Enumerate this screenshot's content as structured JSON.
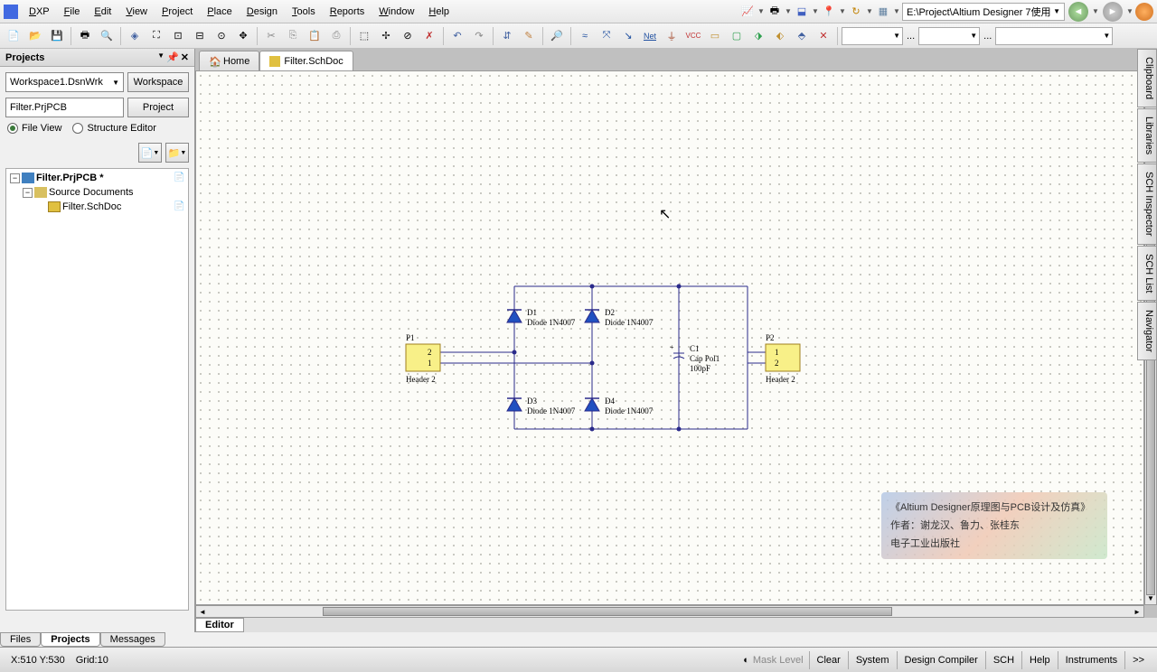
{
  "menubar": {
    "app": "DXP",
    "items": [
      "File",
      "Edit",
      "View",
      "Project",
      "Place",
      "Design",
      "Tools",
      "Reports",
      "Window",
      "Help"
    ],
    "path": "E:\\Project\\Altium Designer 7使用"
  },
  "projects_panel": {
    "title": "Projects",
    "workspace_combo": "Workspace1.DsnWrk",
    "workspace_btn": "Workspace",
    "project_field": "Filter.PrjPCB",
    "project_btn": "Project",
    "radio_file_view": "File View",
    "radio_structure": "Structure Editor",
    "tree": {
      "project": "Filter.PrjPCB *",
      "folder": "Source Documents",
      "doc": "Filter.SchDoc"
    }
  },
  "tabs": {
    "home": "Home",
    "doc": "Filter.SchDoc",
    "editor": "Editor"
  },
  "panel_tabs": {
    "files": "Files",
    "projects": "Projects",
    "messages": "Messages"
  },
  "right_tabs": [
    "Clipboard",
    "Libraries",
    "SCH Inspector",
    "SCH List",
    "Navigator"
  ],
  "schematic": {
    "p1": {
      "ref": "P1",
      "type": "Header 2",
      "pin1": "1",
      "pin2": "2"
    },
    "p2": {
      "ref": "P2",
      "type": "Header 2",
      "pin1": "1",
      "pin2": "2"
    },
    "d1": {
      "ref": "D1",
      "type": "Diode 1N4007"
    },
    "d2": {
      "ref": "D2",
      "type": "Diode 1N4007"
    },
    "d3": {
      "ref": "D3",
      "type": "Diode 1N4007"
    },
    "d4": {
      "ref": "D4",
      "type": "Diode 1N4007"
    },
    "c1": {
      "ref": "C1",
      "type": "Cap Pol1",
      "value": "100pF"
    }
  },
  "watermark": {
    "line1": "《Altium Designer原理图与PCB设计及仿真》",
    "line2": "作者：谢龙汉、鲁力、张桂东",
    "line3": "电子工业出版社"
  },
  "statusbar": {
    "coords": "X:510 Y:530",
    "grid": "Grid:10",
    "mask": "Mask Level",
    "clear": "Clear",
    "buttons": [
      "System",
      "Design Compiler",
      "SCH",
      "Help",
      "Instruments",
      ">>"
    ]
  },
  "toolbar_text": {
    "net": "Net",
    "vcc": "VCC"
  },
  "controls": {
    "ellipsis": "..."
  }
}
